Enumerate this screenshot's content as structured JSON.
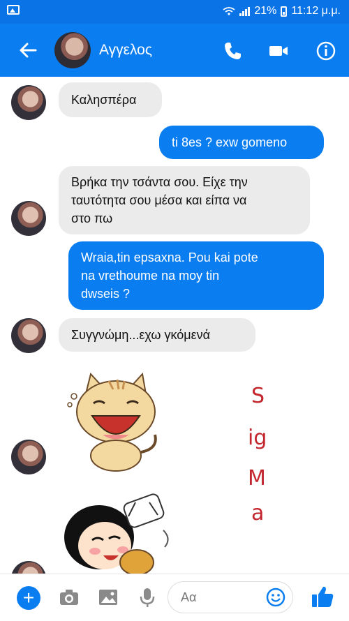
{
  "status": {
    "battery": "21%",
    "time": "11:12 μ.μ."
  },
  "header": {
    "contact_name": "Αγγελος"
  },
  "messages": [
    {
      "dir": "in",
      "text": "Καλησπέρα"
    },
    {
      "dir": "out",
      "text": "ti 8es ? exw gomeno"
    },
    {
      "dir": "in",
      "lines": [
        "Βρήκα την τσάντα σου. Είχε την",
        "ταυτότητα σου μέσα και είπα να",
        "στο πω"
      ]
    },
    {
      "dir": "out",
      "lines": [
        "Wraia,tin epsaxna. Pou kai pote",
        "na vrethoume na moy tin",
        "dwseis ?"
      ]
    },
    {
      "dir": "in",
      "text": "Συγγνώμη...εχω γκόμενά"
    }
  ],
  "overlay_text": [
    "S",
    "ig",
    "M",
    "a"
  ],
  "composer": {
    "placeholder": "Aα"
  },
  "colors": {
    "brand_blue": "#0a7df0",
    "status_blue": "#0a74e6",
    "incoming_bubble": "#ebebeb",
    "overlay_red": "#c4262e"
  },
  "icons": [
    "back-arrow-icon",
    "phone-icon",
    "video-icon",
    "info-icon",
    "plus-icon",
    "camera-icon",
    "image-icon",
    "mic-icon",
    "emoji-icon",
    "like-icon"
  ]
}
